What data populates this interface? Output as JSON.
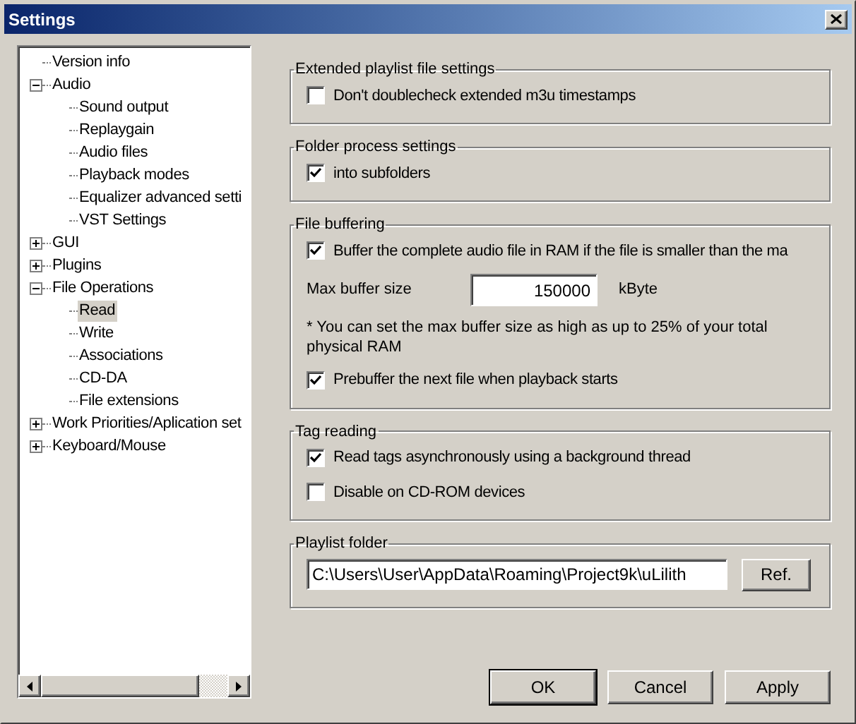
{
  "window": {
    "title": "Settings"
  },
  "tree": [
    {
      "label": "Version info",
      "selected": false
    },
    {
      "label": "Audio",
      "selected": false,
      "expanded": true,
      "children": [
        {
          "label": "Sound output",
          "selected": false
        },
        {
          "label": "Replaygain",
          "selected": false
        },
        {
          "label": "Audio files",
          "selected": false
        },
        {
          "label": "Playback modes",
          "selected": false
        },
        {
          "label": "Equalizer advanced setti",
          "selected": false
        },
        {
          "label": "VST Settings",
          "selected": false
        }
      ]
    },
    {
      "label": "GUI",
      "selected": false,
      "expanded": false
    },
    {
      "label": "Plugins",
      "selected": false,
      "expanded": false
    },
    {
      "label": "File Operations",
      "selected": false,
      "expanded": true,
      "children": [
        {
          "label": "Read",
          "selected": true
        },
        {
          "label": "Write",
          "selected": false
        },
        {
          "label": "Associations",
          "selected": false
        },
        {
          "label": "CD-DA",
          "selected": false
        },
        {
          "label": "File extensions",
          "selected": false
        }
      ]
    },
    {
      "label": "Work Priorities/Aplication set",
      "selected": false,
      "expanded": false
    },
    {
      "label": "Keyboard/Mouse",
      "selected": false,
      "expanded": false
    }
  ],
  "groups": [
    {
      "title": "Extended playlist file settings",
      "items": [
        {
          "kind": "checkbox",
          "label": "Don't doublecheck extended m3u timestamps",
          "checked": false
        }
      ]
    },
    {
      "title": "Folder process settings",
      "items": [
        {
          "kind": "checkbox",
          "label": "into subfolders",
          "checked": true
        }
      ]
    },
    {
      "title": "File buffering",
      "items": [
        {
          "kind": "checkbox",
          "label": "Buffer the complete audio file in RAM if the file is smaller than the ma",
          "checked": true
        },
        {
          "kind": "number",
          "label": "Max buffer size",
          "value": "150000",
          "unit": "kByte"
        },
        {
          "kind": "note",
          "text": "* You can set the max buffer size as high as up to 25% of your total physical RAM"
        },
        {
          "kind": "checkbox",
          "label": "Prebuffer the next file when playback starts",
          "checked": true
        }
      ]
    },
    {
      "title": "Tag reading",
      "items": [
        {
          "kind": "checkbox",
          "label": "Read tags asynchronously using a background thread",
          "checked": true
        },
        {
          "kind": "checkbox",
          "label": "Disable on CD-ROM devices",
          "checked": false
        }
      ]
    },
    {
      "title": "Playlist folder",
      "items": [
        {
          "kind": "path",
          "value": "C:\\Users\\User\\AppData\\Roaming\\Project9k\\uLilith",
          "button": "Ref."
        }
      ]
    }
  ],
  "buttons": [
    {
      "label": "OK",
      "default": true
    },
    {
      "label": "Cancel",
      "default": false
    },
    {
      "label": "Apply",
      "default": false
    }
  ]
}
